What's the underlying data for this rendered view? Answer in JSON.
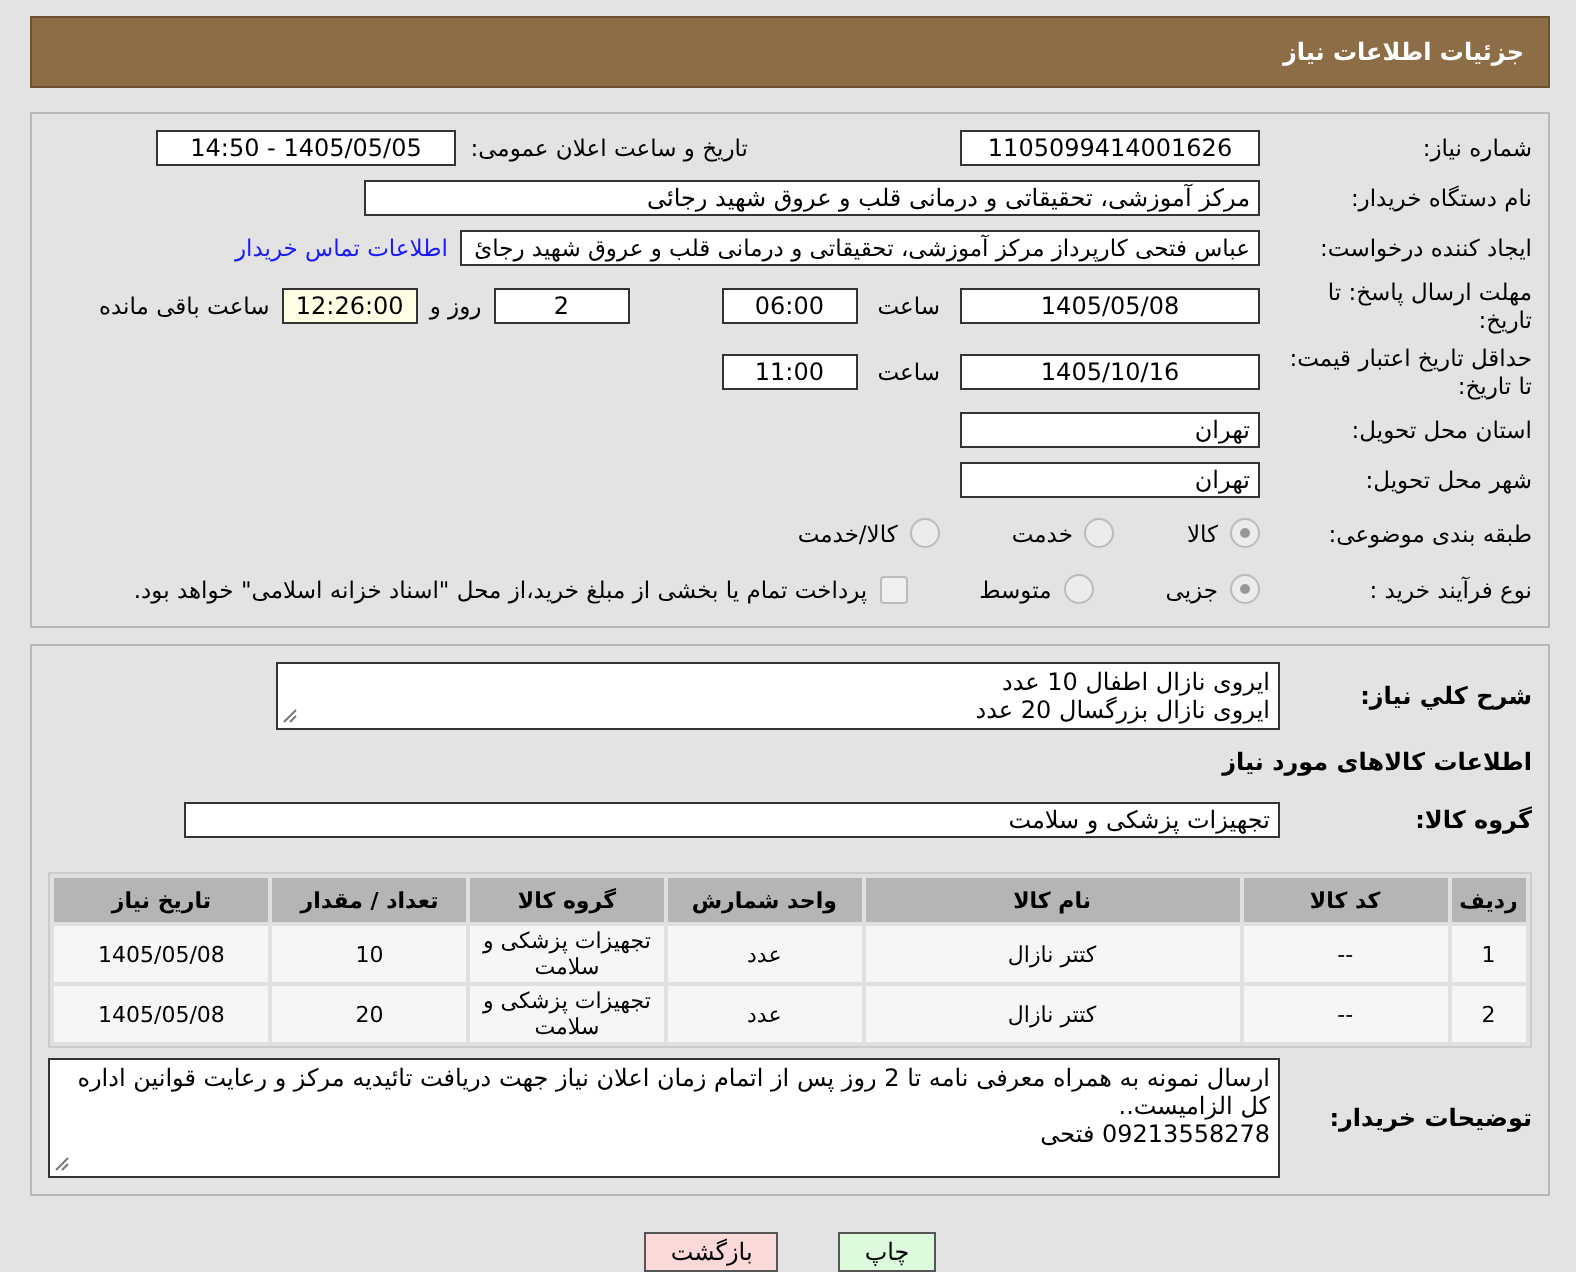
{
  "header": {
    "title": "جزئیات اطلاعات نیاز"
  },
  "info": {
    "need_number": {
      "label": "شماره نیاز:",
      "value": "1105099414001626"
    },
    "announce": {
      "label": "تاریخ و ساعت اعلان عمومی:",
      "value": "1405/05/05 - 14:50"
    },
    "buyer": {
      "label": "نام دستگاه خریدار:",
      "value": "مرکز آموزشی، تحقیقاتی و درمانی قلب و عروق شهید رجائی"
    },
    "requester": {
      "label": "ایجاد کننده درخواست:",
      "value": "عباس فتحی کارپرداز مرکز آموزشی، تحقیقاتی و درمانی قلب و عروق شهید رجائ",
      "link": "اطلاعات تماس خریدار"
    },
    "deadline": {
      "label": "مهلت ارسال پاسخ: تا تاریخ:",
      "date": "1405/05/08",
      "time_label": "ساعت",
      "time": "06:00",
      "days": "2",
      "days_label": "روز و",
      "remaining": "12:26:00",
      "remaining_label": "ساعت باقی مانده"
    },
    "validity": {
      "label": "حداقل تاریخ اعتبار قیمت: تا تاریخ:",
      "date": "1405/10/16",
      "time_label": "ساعت",
      "time": "11:00"
    },
    "province": {
      "label": "استان محل تحویل:",
      "value": "تهران"
    },
    "city": {
      "label": "شهر محل تحویل:",
      "value": "تهران"
    },
    "category": {
      "label": "طبقه بندی موضوعی:",
      "options": [
        {
          "label": "کالا",
          "selected": true
        },
        {
          "label": "خدمت",
          "selected": false
        },
        {
          "label": "کالا/خدمت",
          "selected": false
        }
      ]
    },
    "process": {
      "label": "نوع فرآیند خرید :",
      "options": [
        {
          "label": "جزیی",
          "selected": true
        },
        {
          "label": "متوسط",
          "selected": false
        }
      ],
      "treasury": {
        "checked": false,
        "label": "پرداخت تمام یا بخشی از مبلغ خرید،از محل \"اسناد خزانه اسلامی\" خواهد بود."
      }
    }
  },
  "details": {
    "description": {
      "label": "شرح کلي نياز:",
      "lines": [
        "ایروی نازال اطفال 10 عدد",
        "ایروی نازال بزرگسال 20 عدد"
      ]
    },
    "goods_title": "اطلاعات کالاهای مورد نیاز",
    "group": {
      "label": "گروه کالا:",
      "value": "تجهیزات پزشکی و سلامت"
    },
    "table": {
      "columns": [
        "ردیف",
        "کد کالا",
        "نام کالا",
        "واحد شمارش",
        "گروه کالا",
        "تعداد / مقدار",
        "تاریخ نیاز"
      ],
      "rows": [
        [
          "1",
          "--",
          "کتتر نازال",
          "عدد",
          "تجهیزات پزشکی و سلامت",
          "10",
          "1405/05/08"
        ],
        [
          "2",
          "--",
          "کتتر نازال",
          "عدد",
          "تجهیزات پزشکی و سلامت",
          "20",
          "1405/05/08"
        ]
      ]
    },
    "notes": {
      "label": "توضیحات خریدار:",
      "lines": [
        "ارسال نمونه به همراه معرفی نامه تا 2 روز پس از اتمام زمان اعلان نیاز جهت دریافت تائیدیه مرکز و رعایت قوانین اداره کل الزامیست..",
        "09213558278 فتحی"
      ]
    }
  },
  "buttons": [
    {
      "label": "چاپ",
      "kind": "print"
    },
    {
      "label": "بازگشت",
      "kind": "back"
    }
  ]
}
